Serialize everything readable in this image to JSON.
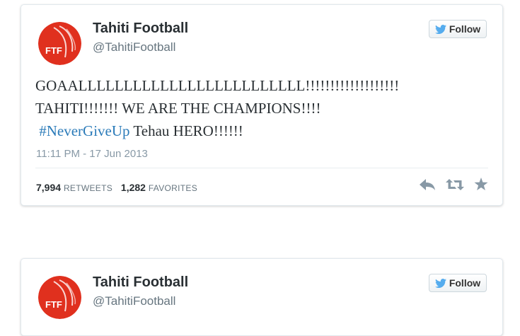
{
  "tweets": [
    {
      "account": {
        "name": "Tahiti Football",
        "handle": "@TahitiFootball",
        "avatar_text": "FTF"
      },
      "follow_label": "Follow",
      "text_lines": [
        "GOAALLLLLLLLLLLLLLLLLLLLLLLLL!!!!!!!!!!!!!!!!!!!",
        "TAHITI!!!!!!! WE ARE THE CHAMPIONS!!!!"
      ],
      "hashtag": "#NeverGiveUp",
      "text_after_hashtag": " Tehau HERO!!!!!!",
      "timestamp": "11:11 PM - 17 Jun 2013",
      "retweets_count": "7,994",
      "retweets_label": "RETWEETS",
      "favorites_count": "1,282",
      "favorites_label": "FAVORITES"
    },
    {
      "account": {
        "name": "Tahiti Football",
        "handle": "@TahitiFootball",
        "avatar_text": "FTF"
      },
      "follow_label": "Follow"
    }
  ],
  "colors": {
    "hashtag": "#2b7bb9",
    "avatar_red": "#e0301e",
    "twitter_bird": "#55acee",
    "icon_gray": "#8899a6"
  },
  "icons": [
    "twitter-bird-icon",
    "reply-icon",
    "retweet-icon",
    "favorite-star-icon"
  ]
}
